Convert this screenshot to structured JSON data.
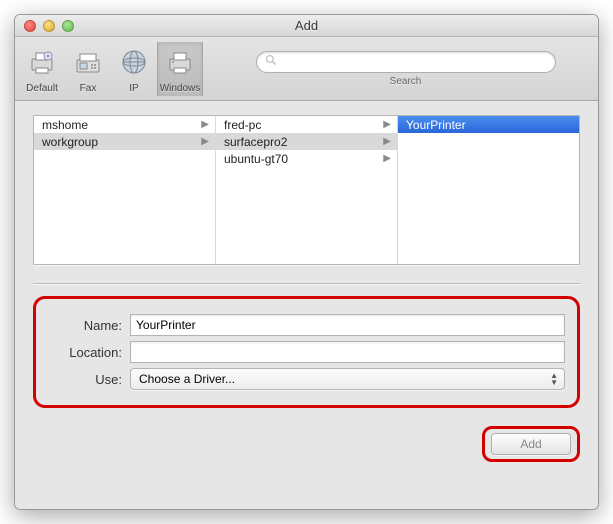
{
  "window": {
    "title": "Add"
  },
  "toolbar": {
    "items": [
      {
        "label": "Default"
      },
      {
        "label": "Fax"
      },
      {
        "label": "IP"
      },
      {
        "label": "Windows"
      }
    ],
    "search_placeholder": "",
    "search_label": "Search"
  },
  "browser": {
    "col0": [
      {
        "label": "mshome"
      },
      {
        "label": "workgroup"
      }
    ],
    "col1": [
      {
        "label": "fred-pc"
      },
      {
        "label": "surfacepro2"
      },
      {
        "label": "ubuntu-gt70"
      }
    ],
    "col2": [
      {
        "label": "YourPrinter"
      }
    ]
  },
  "form": {
    "name_label": "Name:",
    "name_value": "YourPrinter",
    "location_label": "Location:",
    "location_value": "",
    "use_label": "Use:",
    "use_value": "Choose a Driver..."
  },
  "footer": {
    "add_label": "Add"
  }
}
